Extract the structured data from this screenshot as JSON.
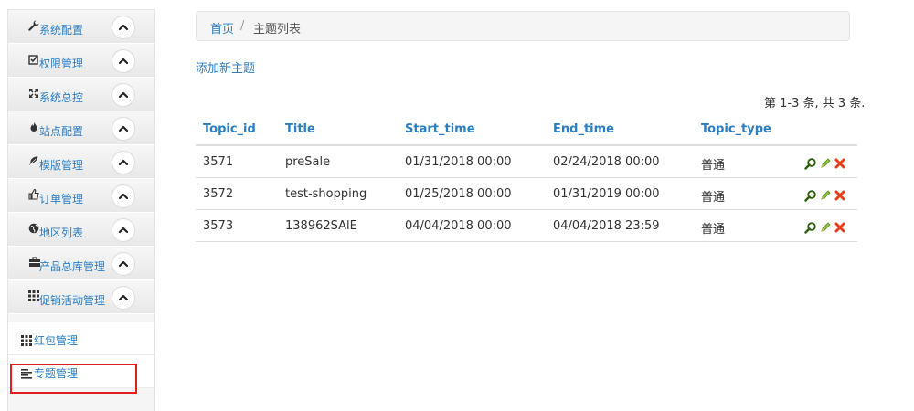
{
  "sidebar": {
    "items": [
      {
        "label": "系统配置",
        "icon": "wrench-icon"
      },
      {
        "label": "权限管理",
        "icon": "check-square-icon"
      },
      {
        "label": "系统总控",
        "icon": "fullscreen-icon"
      },
      {
        "label": "站点配置",
        "icon": "fire-icon"
      },
      {
        "label": "模版管理",
        "icon": "leaf-icon"
      },
      {
        "label": "订单管理",
        "icon": "thumbs-up-icon"
      },
      {
        "label": "地区列表",
        "icon": "globe-icon"
      },
      {
        "label": "产品总库管理",
        "icon": "briefcase-icon"
      },
      {
        "label": "促销活动管理",
        "icon": "grid-icon"
      }
    ],
    "sub_items": [
      {
        "label": "红包管理",
        "icon": "grid-icon"
      },
      {
        "label": "专题管理",
        "icon": "align-left-icon"
      }
    ]
  },
  "breadcrumb": {
    "home": "首页",
    "separator": "/",
    "current": "主题列表"
  },
  "add_link": "添加新主题",
  "pager_info": "第 1-3 条, 共 3 条.",
  "table": {
    "headers": [
      "Topic_id",
      "Title",
      "Start_time",
      "End_time",
      "Topic_type"
    ],
    "rows": [
      [
        "3571",
        "preSale",
        "01/31/2018 00:00",
        "02/24/2018 00:00",
        "普通"
      ],
      [
        "3572",
        "test-shopping",
        "01/25/2018 00:00",
        "01/31/2019 00:00",
        "普通"
      ],
      [
        "3573",
        "138962SAlE",
        "04/04/2018 00:00",
        "04/04/2018 23:59",
        "普通"
      ]
    ],
    "action_icons": [
      "search-icon",
      "edit-icon",
      "delete-icon"
    ]
  },
  "colors": {
    "link": "#2b7ec1",
    "highlight": "#e01e1e"
  }
}
